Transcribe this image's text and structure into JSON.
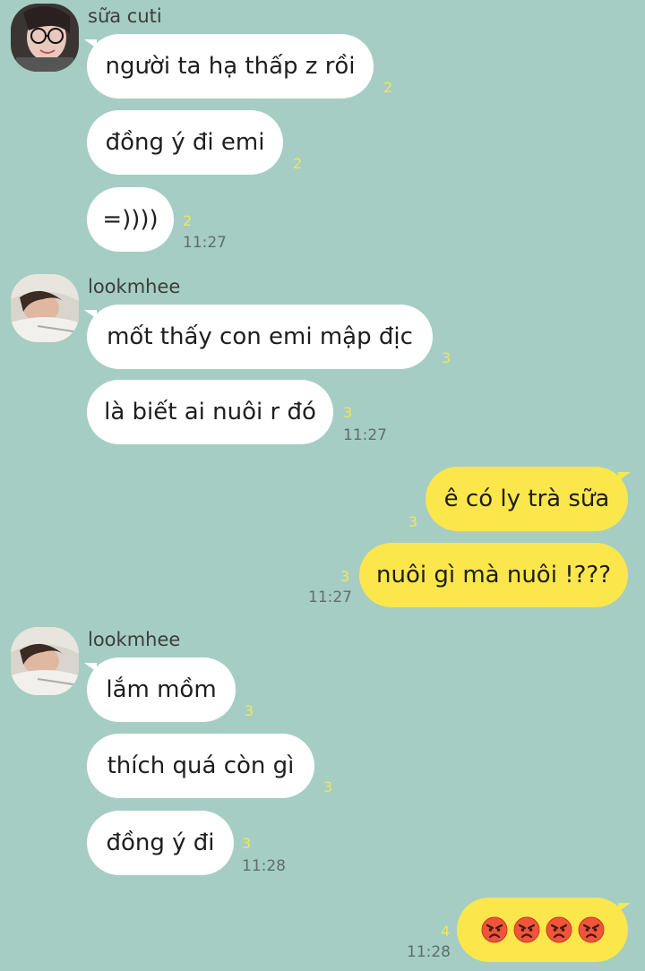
{
  "colors": {
    "background": "#a5cdc3",
    "incoming_bubble": "#ffffff",
    "outgoing_bubble": "#fbe74b",
    "read_count": "#f3e55a",
    "timestamp": "#5f6e6a"
  },
  "groups": [
    {
      "sender": "sữa cuti",
      "avatar_icon": "girl-with-glasses-avatar",
      "messages": [
        {
          "text": "người ta hạ thấp z rồi",
          "read": "2"
        },
        {
          "text": "đồng ý đi emi",
          "read": "2"
        },
        {
          "text": "=))))",
          "read": "2",
          "time": "11:27"
        }
      ]
    },
    {
      "sender": "lookmhee",
      "avatar_icon": "lying-person-avatar",
      "messages": [
        {
          "text": "mốt thấy con emi mập địc",
          "read": "3"
        },
        {
          "text": "là biết ai nuôi r đó",
          "read": "3",
          "time": "11:27"
        }
      ]
    },
    {
      "sender": "",
      "outgoing": true,
      "messages": [
        {
          "text": "ê có ly trà sữa",
          "read": "3"
        },
        {
          "text": "nuôi gì mà nuôi !???",
          "read": "3",
          "time": "11:27"
        }
      ]
    },
    {
      "sender": "lookmhee",
      "avatar_icon": "lying-person-avatar",
      "messages": [
        {
          "text": "lắm mồm",
          "read": "3"
        },
        {
          "text": "thích quá còn gì",
          "read": "3"
        },
        {
          "text": "đồng ý đi",
          "read": "3",
          "time": "11:28"
        }
      ]
    },
    {
      "sender": "",
      "outgoing": true,
      "messages": [
        {
          "emoji": [
            "angry-face-emoji",
            "angry-face-emoji",
            "angry-face-emoji",
            "angry-face-emoji"
          ],
          "read": "4",
          "time": "11:28"
        }
      ]
    }
  ]
}
